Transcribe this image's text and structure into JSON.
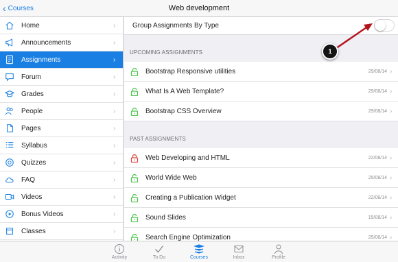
{
  "navbar": {
    "back_label": "Courses",
    "title": "Web development"
  },
  "sidebar": {
    "items": [
      {
        "label": "Home",
        "icon": "home-icon"
      },
      {
        "label": "Announcements",
        "icon": "megaphone-icon"
      },
      {
        "label": "Assignments",
        "icon": "assignment-icon",
        "active": true
      },
      {
        "label": "Forum",
        "icon": "forum-icon"
      },
      {
        "label": "Grades",
        "icon": "grades-icon"
      },
      {
        "label": "People",
        "icon": "people-icon"
      },
      {
        "label": "Pages",
        "icon": "pages-icon"
      },
      {
        "label": "Syllabus",
        "icon": "syllabus-icon"
      },
      {
        "label": "Quizzes",
        "icon": "quizzes-icon"
      },
      {
        "label": "FAQ",
        "icon": "cloud-icon"
      },
      {
        "label": "Videos",
        "icon": "video-icon"
      },
      {
        "label": "Bonus Videos",
        "icon": "bonus-video-icon"
      },
      {
        "label": "Classes",
        "icon": "classes-icon"
      }
    ]
  },
  "main": {
    "toggle_label": "Group Assignments By Type",
    "upcoming_header": "UPCOMING ASSIGNMENTS",
    "upcoming": [
      {
        "title": "Bootstrap Responsive utilities",
        "date": "29/08/14",
        "locked": false
      },
      {
        "title": "What Is A Web Template?",
        "date": "29/08/14",
        "locked": false
      },
      {
        "title": "Bootstrap CSS Overview",
        "date": "29/08/14",
        "locked": false
      }
    ],
    "past_header": "PAST ASSIGNMENTS",
    "past": [
      {
        "title": "Web Developing and HTML",
        "date": "22/08/14",
        "locked": true
      },
      {
        "title": "World Wide Web",
        "date": "25/08/14",
        "locked": false
      },
      {
        "title": "Creating a Publication Widget",
        "date": "22/08/14",
        "locked": false
      },
      {
        "title": "Sound Slides",
        "date": "15/08/14",
        "locked": false
      },
      {
        "title": "Search Engine Optimization",
        "date": "25/08/14",
        "locked": false
      }
    ]
  },
  "tabbar": {
    "tabs": [
      {
        "label": "Activity",
        "icon": "activity-icon"
      },
      {
        "label": "To Do",
        "icon": "checkmark-icon"
      },
      {
        "label": "Courses",
        "icon": "courses-icon",
        "active": true
      },
      {
        "label": "Inbox",
        "icon": "inbox-icon"
      },
      {
        "label": "Profile",
        "icon": "profile-icon"
      }
    ]
  },
  "callout": {
    "number": "1"
  },
  "colors": {
    "accent": "#1a7fe3",
    "unlocked": "#4cc24a",
    "locked": "#e0443c",
    "callout_arrow": "#b3151f"
  }
}
